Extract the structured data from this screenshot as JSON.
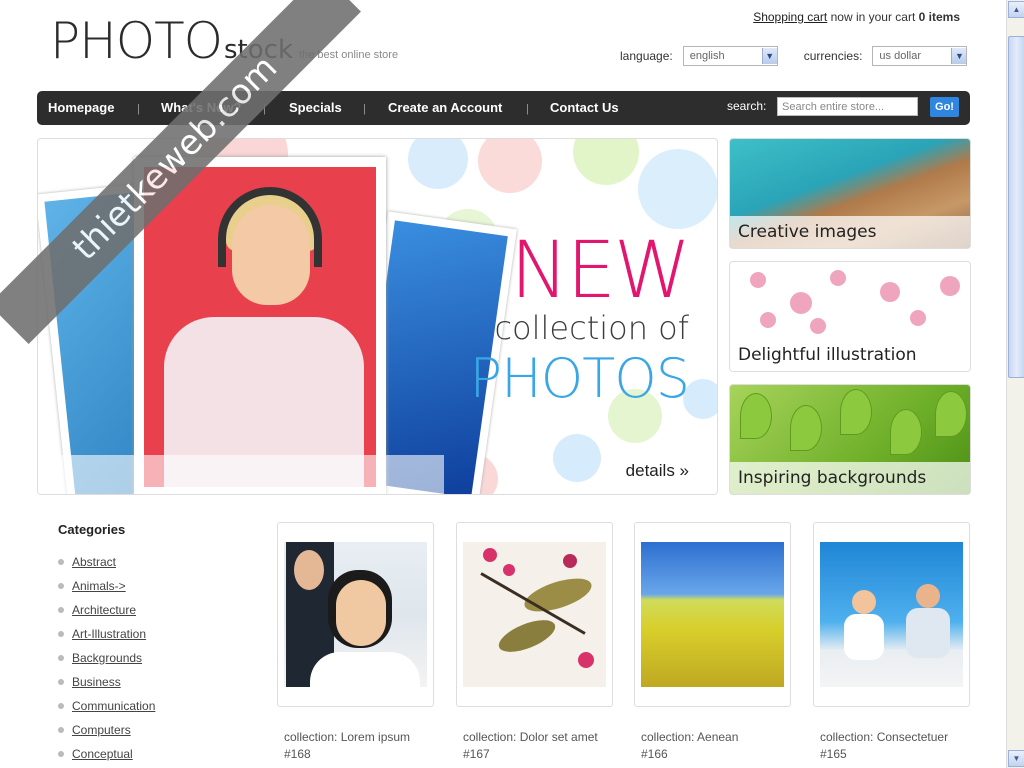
{
  "header": {
    "logo_main": "PHOTO",
    "logo_sub": "stock",
    "tagline": "the best online store",
    "cart_link": "Shopping cart",
    "cart_text": "now in your cart",
    "cart_count": "0 items",
    "language_label": "language:",
    "language_value": "english",
    "currency_label": "currencies:",
    "currency_value": "us dollar"
  },
  "nav": {
    "items": [
      "Homepage",
      "What's New?",
      "Specials",
      "Create an Account",
      "Contact Us"
    ],
    "search_label": "search:",
    "search_placeholder": "Search entire store...",
    "search_button": "Go!"
  },
  "banner": {
    "line1": "NEW",
    "line2": "collection of",
    "line3": "PHOTOS",
    "details": "details »"
  },
  "promos": [
    {
      "caption": "Creative images"
    },
    {
      "caption": "Delightful illustration"
    },
    {
      "caption": "Inspiring backgrounds"
    }
  ],
  "sidebar": {
    "title": "Categories",
    "items": [
      "Abstract",
      "Animals->",
      "Architecture",
      "Art-Illustration",
      "Backgrounds",
      "Business",
      "Communication",
      "Computers",
      "Conceptual"
    ]
  },
  "products": [
    {
      "line1": "collection:  Lorem ipsum",
      "line2": "#168"
    },
    {
      "line1": "collection:  Dolor set amet",
      "line2": "#167"
    },
    {
      "line1": "collection:  Aenean",
      "line2": "#166"
    },
    {
      "line1": "collection:  Consectetuer",
      "line2": "#165"
    }
  ],
  "watermark": "thietkeweb.com",
  "colors": {
    "accent_pink": "#e2156f",
    "accent_blue": "#39a6e6",
    "nav_bg": "#2d2d2d",
    "go_button": "#2f86e1"
  }
}
